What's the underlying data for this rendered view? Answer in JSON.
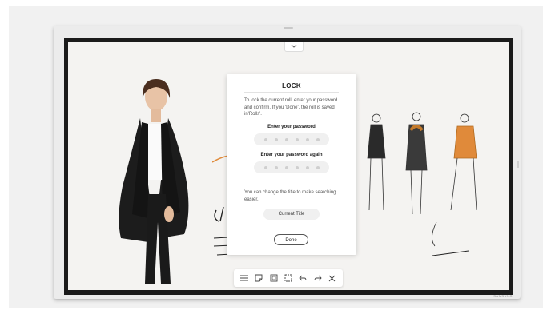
{
  "dialog": {
    "title": "LOCK",
    "description": "To lock the current roll, enter your password and confirm. If you 'Done', the roll is saved in'Rolls'.",
    "password_label": "Enter your password",
    "password_again_label": "Enter your password again",
    "title_hint": "You can change the title to make searching easier.",
    "title_button": "Current Title",
    "done_button": "Done"
  },
  "device": {
    "brand": "SAMSUNG"
  },
  "toolbar": {
    "icons": [
      "menu-icon",
      "sticky-note-icon",
      "clipboard-icon",
      "select-icon",
      "undo-icon",
      "redo-icon",
      "close-icon"
    ]
  },
  "colors": {
    "accent_orange": "#e08a3a",
    "bezel": "#1b1b1b",
    "canvas": "#f4f3f1"
  }
}
